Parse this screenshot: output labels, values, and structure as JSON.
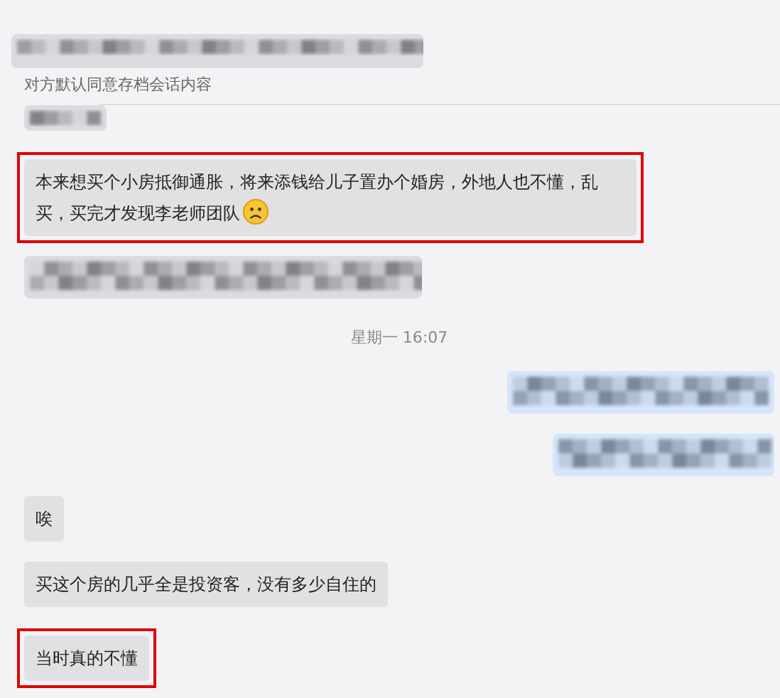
{
  "header": {
    "kind": "redacted",
    "notice": "对方默认同意存档会话内容"
  },
  "messages": [
    {
      "kind": "redacted",
      "outgoing": false,
      "highlighted": false
    },
    {
      "kind": "text",
      "outgoing": false,
      "text": "本来想买个小房抵御通胀，将来添钱给儿子置办个婚房，外地人也不懂，乱买，买完才发现李老师团队",
      "has_emoji": true,
      "highlighted": true
    },
    {
      "kind": "redacted",
      "outgoing": false,
      "highlighted": false
    },
    {
      "kind": "time",
      "text": "星期一 16:07"
    },
    {
      "kind": "redacted",
      "outgoing": true,
      "highlighted": false
    },
    {
      "kind": "redacted",
      "outgoing": true,
      "highlighted": false
    },
    {
      "kind": "text",
      "outgoing": false,
      "text": "唉",
      "has_emoji": false,
      "highlighted": false
    },
    {
      "kind": "text",
      "outgoing": false,
      "text": "买这个房的几乎全是投资客，没有多少自住的",
      "has_emoji": false,
      "highlighted": false
    },
    {
      "kind": "text",
      "outgoing": false,
      "text": "当时真的不懂",
      "has_emoji": false,
      "highlighted": true
    }
  ]
}
